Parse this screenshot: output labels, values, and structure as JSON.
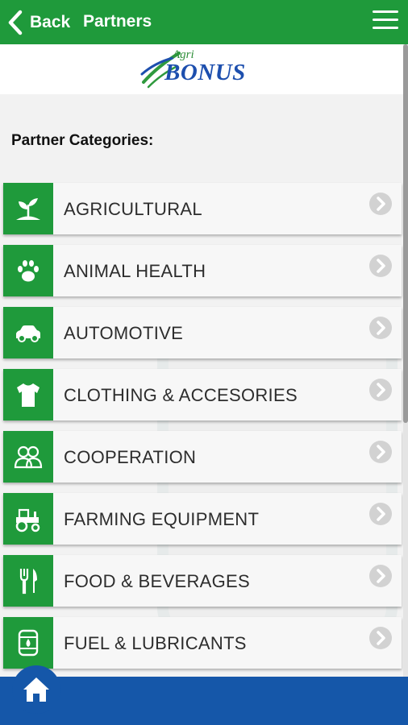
{
  "header": {
    "back_label": "Back",
    "title": "Partners",
    "back_icon": "chevron-left-icon",
    "menu_icon": "hamburger-menu-icon"
  },
  "logo": {
    "agri": "Agri",
    "bonus": "BONUS"
  },
  "section_title": "Partner Categories:",
  "categories": [
    {
      "label": "AGRICULTURAL",
      "icon": "plant-sprout-icon"
    },
    {
      "label": "ANIMAL HEALTH",
      "icon": "paw-print-icon"
    },
    {
      "label": "AUTOMOTIVE",
      "icon": "car-icon"
    },
    {
      "label": "CLOTHING & ACCESORIES",
      "icon": "tshirt-icon"
    },
    {
      "label": "COOPERATION",
      "icon": "people-group-icon"
    },
    {
      "label": "FARMING EQUIPMENT",
      "icon": "tractor-icon"
    },
    {
      "label": "FOOD & BEVERAGES",
      "icon": "fork-knife-icon"
    },
    {
      "label": "FUEL & LUBRICANTS",
      "icon": "fuel-barrel-icon"
    }
  ],
  "footer": {
    "home_icon": "home-icon"
  },
  "colors": {
    "green": "#1f9a3b",
    "blue": "#1557a9",
    "logo_blue": "#1d4fae"
  }
}
